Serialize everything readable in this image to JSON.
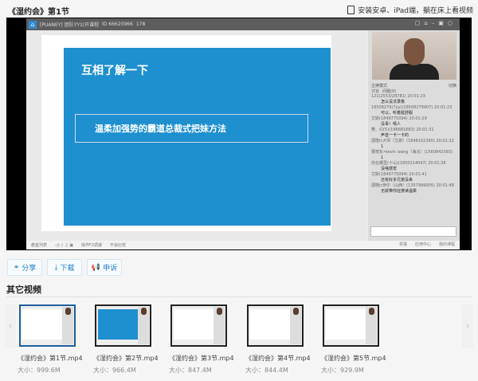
{
  "title": "《湿约会》第1节",
  "install_text": "安装安卓、iPad端，躺在床上看视频",
  "player": {
    "app_title": "[PUANEY] 团队YY公开课程",
    "room_id": "ID 66620966",
    "viewers": "178",
    "slide_heading": "互相了解一下",
    "slide_box": "温柔加强势的霸道总裁式把妹方法",
    "mode_label": "主席模式",
    "mode_action": "切换",
    "tabs": [
      "讨论",
      "问题(0)"
    ],
    "chat": [
      {
        "meta": "121(2553/28781) 20:01:23",
        "msg": "怎么没法录像"
      },
      {
        "meta": "18508279(7yy)(18508279907) 20:01:23",
        "msg": "可以，听着挺舒服"
      },
      {
        "meta": "艾斯(1849775094) 20:01:29",
        "msg": "没事！嘻人"
      },
      {
        "meta": "樊、幻(5)(198681683) 20:01:31",
        "msg": "声音一卡一卡的"
      },
      {
        "meta": "邵隆ic大师（艾斯）(1848102390) 20:01:32",
        "msg": "1"
      },
      {
        "meta": "曹丽东•kevin wang（海北）(1560842093)",
        "msg": "1"
      },
      {
        "meta": "你在哪里(十山)(1850214047) 20:01:38",
        "msg": "没啥感觉"
      },
      {
        "meta": "艾斯(1849775094) 20:01:41",
        "msg": "还有好多兄弟没来"
      },
      {
        "meta": "邵隆ic伊尔（山西）(1357999005) 20:01:48",
        "msg": "无欲带你狂撩读温柔"
      }
    ],
    "toolbar_left": [
      "教室列表",
      "操作F2调速",
      "不会比较"
    ],
    "toolbar_right": [
      "举报",
      "应用中心",
      "我的课程"
    ]
  },
  "actions": {
    "share": "分享",
    "download": "下载",
    "report": "申诉"
  },
  "other_heading": "其它视频",
  "videos": [
    {
      "name": "《湿约会》第1节.mp4",
      "size": "大小：999.6M"
    },
    {
      "name": "《湿约会》第2节.mp4",
      "size": "大小：966.4M"
    },
    {
      "name": "《湿约会》第3节.mp4",
      "size": "大小：847.4M"
    },
    {
      "name": "《湿约会》第4节.mp4",
      "size": "大小：844.4M"
    },
    {
      "name": "《湿约会》第5节.mp4",
      "size": "大小：929.9M"
    }
  ]
}
